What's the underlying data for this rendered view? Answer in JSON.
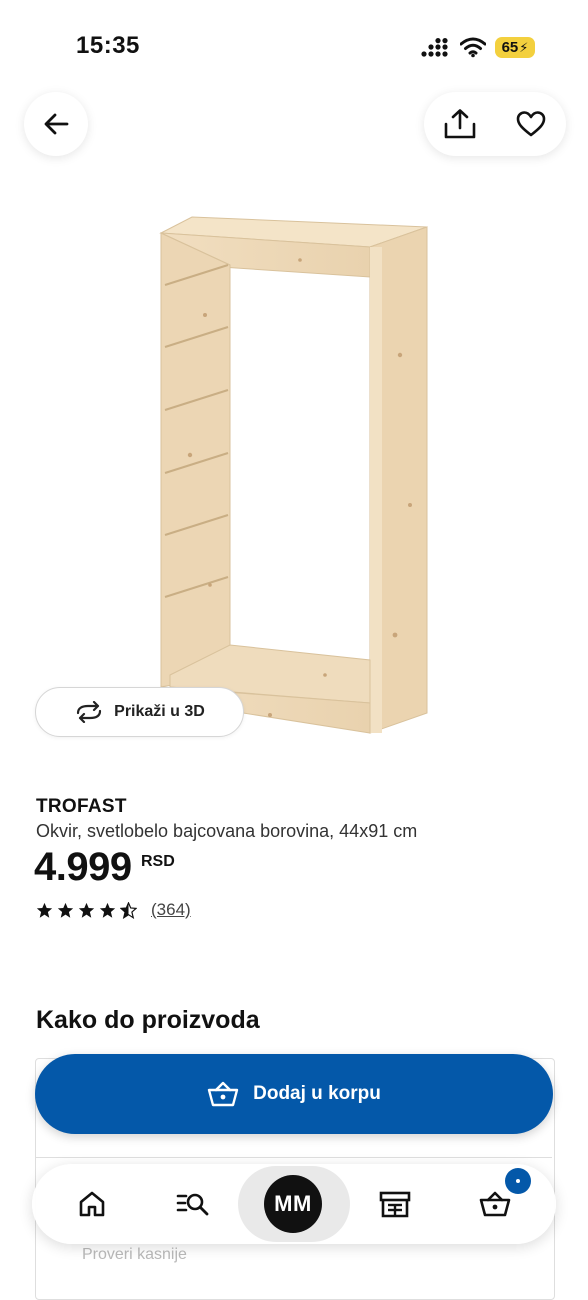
{
  "status_bar": {
    "time": "15:35",
    "battery": "65"
  },
  "product": {
    "view_3d_label": "Prikaži u 3D",
    "brand": "TROFAST",
    "description": "Okvir, svetlobelo bajcovana borovina, 44x91 cm",
    "price": "4.999",
    "currency": "RSD",
    "rating_stars": 4.5,
    "rating_count": "(364)"
  },
  "sections": {
    "availability_title": "Kako do proizvoda"
  },
  "availability": {
    "faded_line": "Proveri kasnije"
  },
  "cart_button": {
    "label": "Dodaj u korpu"
  },
  "bottom_nav": {
    "avatar_initials": "MM"
  },
  "colors": {
    "accent": "#0458a9",
    "battery": "#f3d03e"
  },
  "icons": {
    "back": "arrow-left-icon",
    "share": "share-icon",
    "favorite": "heart-icon",
    "view3d": "rotate-3d-icon",
    "cart": "basket-icon",
    "home": "home-icon",
    "search": "search-list-icon",
    "store": "store-icon"
  }
}
